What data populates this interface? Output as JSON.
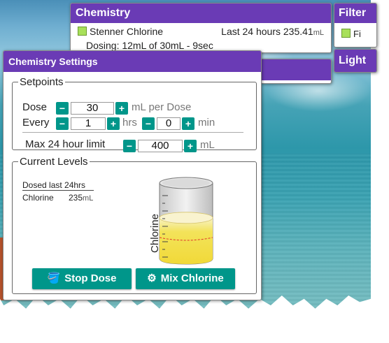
{
  "chemistry_panel": {
    "title": "Chemistry",
    "item_name": "Stenner Chlorine",
    "last24_label": "Last 24 hours",
    "last24_value": "235.41",
    "last24_unit": "mL",
    "dosing_text": "Dosing: 12mL of 30mL - 9sec"
  },
  "filter_panel": {
    "title": "Filter",
    "item_name": "Fi"
  },
  "lights_panel": {
    "title": "Light"
  },
  "settings": {
    "title": "Chemistry Settings",
    "setpoints": {
      "legend": "Setpoints",
      "dose_label": "Dose",
      "dose_value": "30",
      "dose_unit": "mL per Dose",
      "every_label": "Every",
      "hrs_value": "1",
      "hrs_unit": "hrs",
      "min_value": "0",
      "min_unit": "min",
      "max_label": "Max 24 hour limit",
      "max_value": "400",
      "max_unit": "mL"
    },
    "levels": {
      "legend": "Current Levels",
      "dosed_header": "Dosed last 24hrs",
      "chem_name": "Chlorine",
      "chem_value": "235",
      "chem_unit": "mL",
      "beaker_label": "Chlorine",
      "fill_fraction": 0.59
    },
    "buttons": {
      "stop_dose": "Stop Dose",
      "mix": "Mix Chlorine"
    },
    "minus_glyph": "−",
    "plus_glyph": "+"
  },
  "colors": {
    "header_purple": "#6a3bb5",
    "accent_teal": "#00968a",
    "status_green": "#a8e05a",
    "liquid_yellow": "#f1d938"
  }
}
